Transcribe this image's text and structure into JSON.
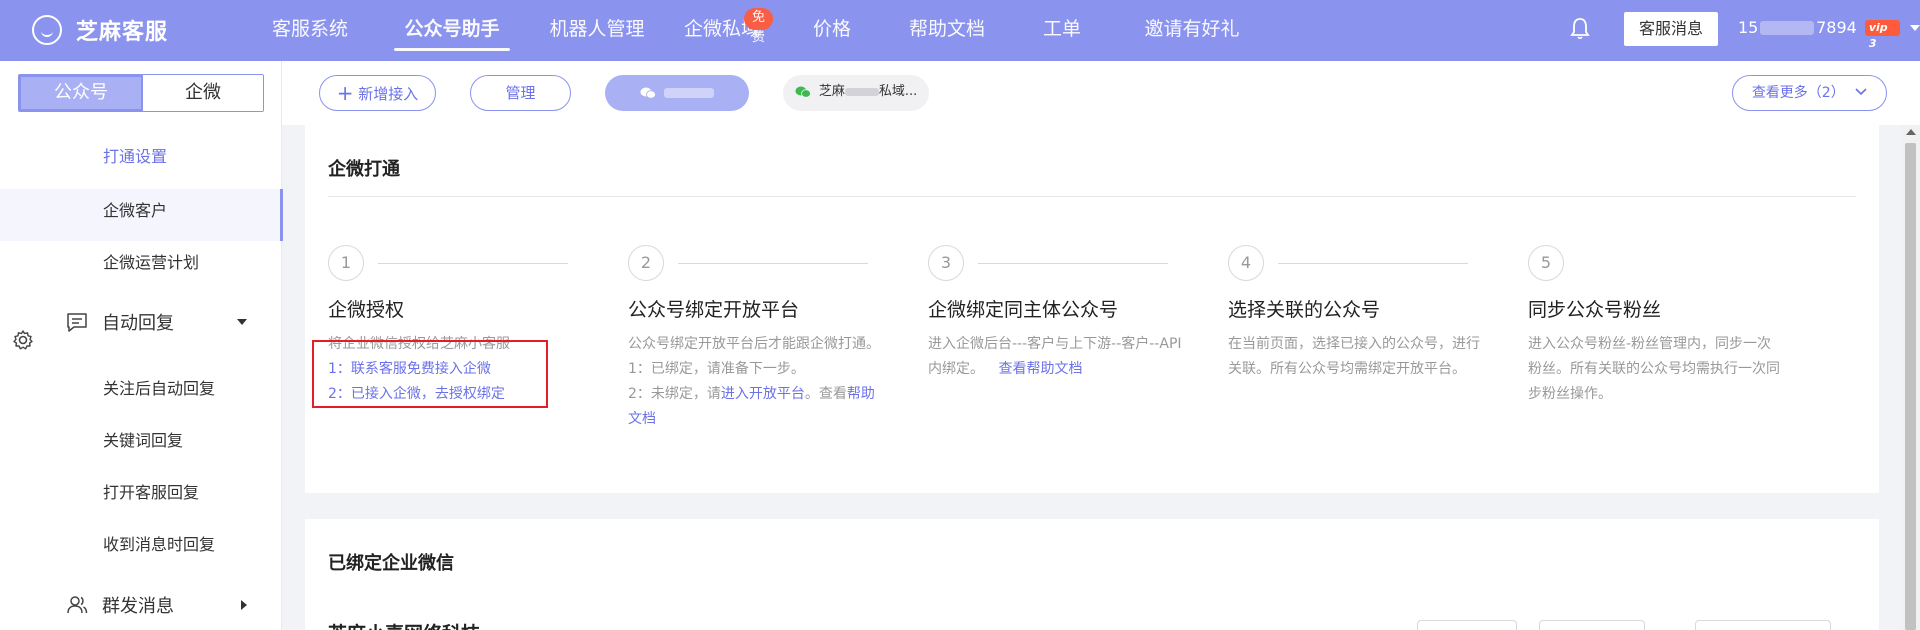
{
  "app": {
    "name": "芝麻客服"
  },
  "nav": {
    "items": [
      {
        "label": "客服系统"
      },
      {
        "label": "公众号助手"
      },
      {
        "label": "机器人管理"
      },
      {
        "label": "企微私域"
      },
      {
        "label": "价格"
      },
      {
        "label": "帮助文档"
      },
      {
        "label": "工单"
      },
      {
        "label": "邀请有好礼"
      }
    ],
    "active_index": 1,
    "free_badge": "免费"
  },
  "header": {
    "kf_message_button": "客服消息",
    "user_prefix": "15",
    "user_suffix": "7894",
    "vip_label": "vip 3",
    "bell_icon": "bell-icon"
  },
  "sidebar": {
    "toggle": {
      "left": "公众号",
      "right": "企微"
    },
    "items": [
      {
        "label": "打通设置",
        "active": true
      },
      {
        "label": "企微客户"
      },
      {
        "label": "企微运营计划"
      }
    ],
    "groups": [
      {
        "label": "自动回复",
        "icon": "chat-icon",
        "expanded": true
      },
      {
        "label": "群发消息",
        "icon": "users-icon",
        "expanded": false
      }
    ],
    "auto_reply_items": [
      {
        "label": "关注后自动回复"
      },
      {
        "label": "关键词回复"
      },
      {
        "label": "打开客服回复"
      },
      {
        "label": "收到消息时回复"
      }
    ]
  },
  "subbar": {
    "add_access": "新增接入",
    "manage": "管理",
    "account_2_label": "芝麻",
    "account_2_suffix": "私域...",
    "view_more": "查看更多（2）"
  },
  "card1": {
    "title": "企微打通",
    "steps": [
      {
        "num": "1",
        "title": "企微授权",
        "desc": "将企业微信授权给芝麻小客服",
        "link1": "1：联系客服免费接入企微",
        "link2": "2：已接入企微，去授权绑定"
      },
      {
        "num": "2",
        "title": "公众号绑定开放平台",
        "desc": "公众号绑定开放平台后才能跟企微打通。",
        "line1": "1：已绑定，请准备下一步。",
        "line2_prefix": "2：未绑定，请",
        "line2_link": "进入开放平台",
        "line2_mid": "。查看",
        "line2_link2": "帮助文档"
      },
      {
        "num": "3",
        "title": "企微绑定同主体公众号",
        "desc": "进入企微后台---客户与上下游--客户--API内绑定。",
        "link": "查看帮助文档"
      },
      {
        "num": "4",
        "title": "选择关联的公众号",
        "desc": "在当前页面，选择已接入的公众号，进行关联。所有公众号均需绑定开放平台。"
      },
      {
        "num": "5",
        "title": "同步公众号粉丝",
        "desc": "进入公众号粉丝-粉丝管理内，同步一次粉丝。所有关联的公众号均需执行一次同步粉丝操作。"
      }
    ]
  },
  "card2": {
    "title": "已绑定企业微信",
    "company_name": "芝麻小喜网络科技"
  }
}
